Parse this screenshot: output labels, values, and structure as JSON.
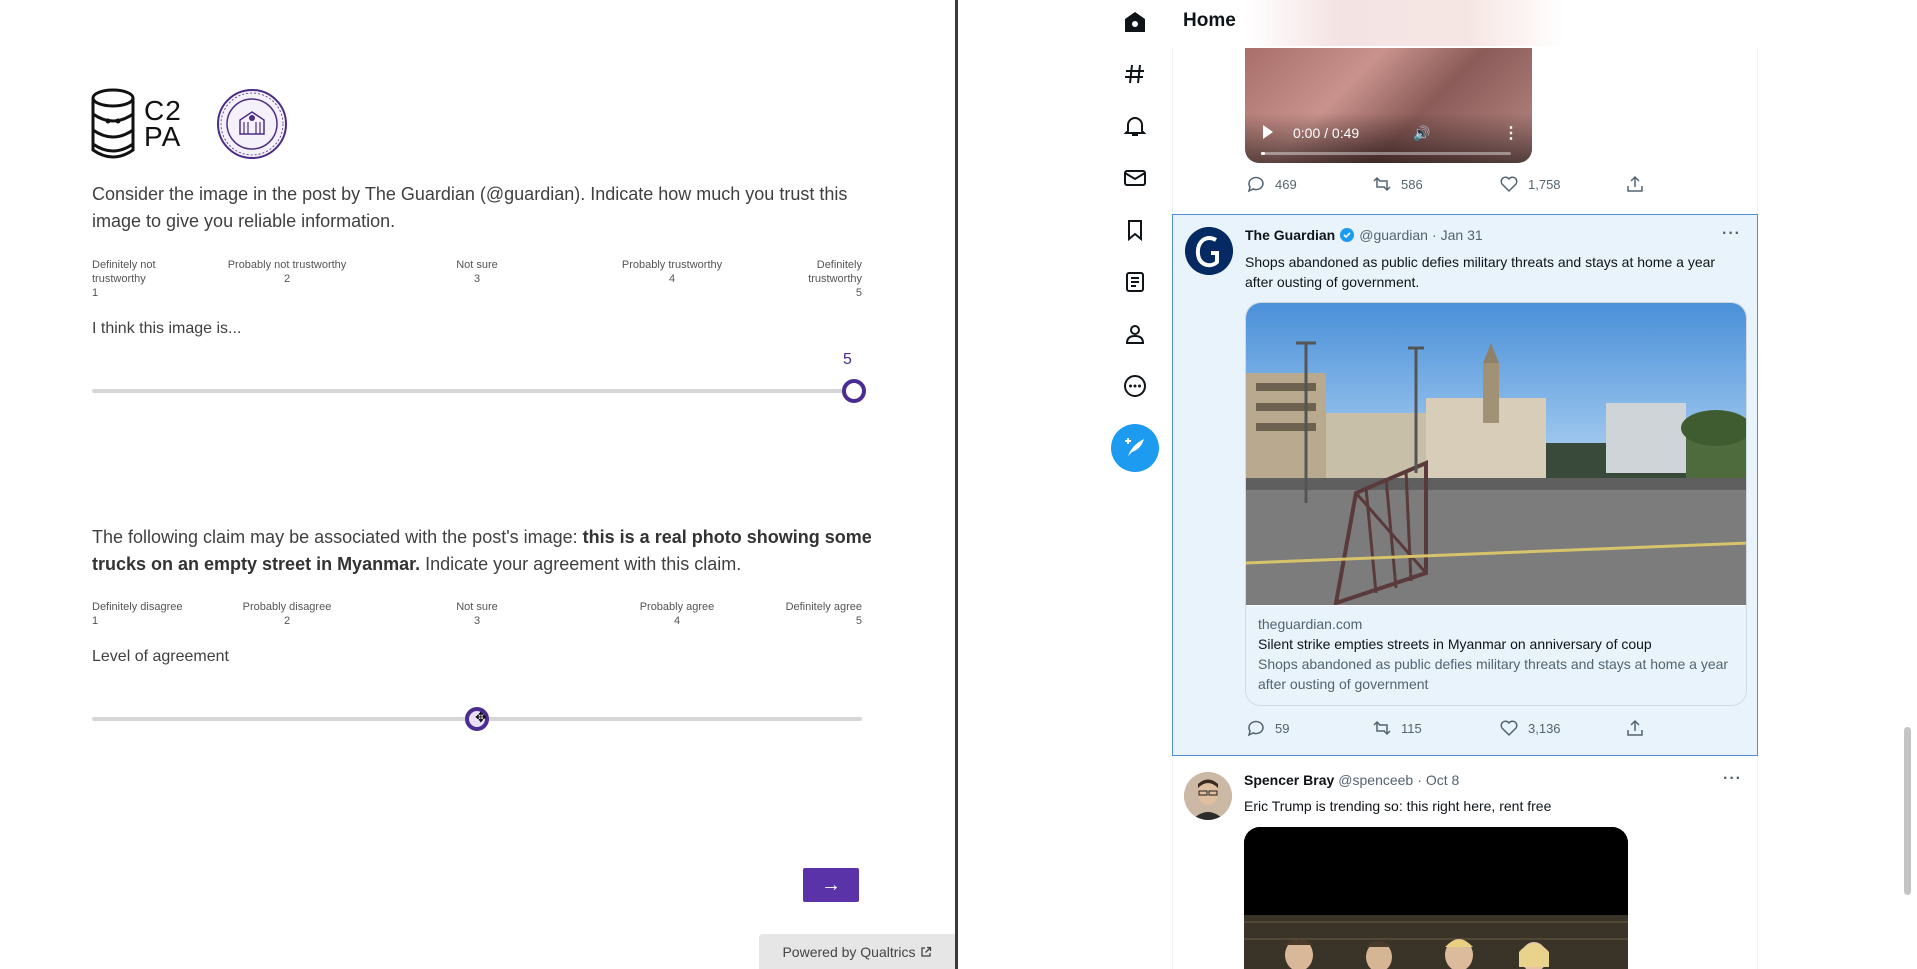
{
  "survey": {
    "logo_text": "C2\nPA",
    "question1": "Consider the image in the post by The Guardian (@guardian). Indicate how much you trust this image to give you reliable information.",
    "scale1": [
      {
        "label": "Definitely not trustworthy",
        "num": "1"
      },
      {
        "label": "Probably not trustworthy",
        "num": "2"
      },
      {
        "label": "Not sure",
        "num": "3"
      },
      {
        "label": "Probably trustworthy",
        "num": "4"
      },
      {
        "label": "Definitely trustworthy",
        "num": "5"
      }
    ],
    "slider1_label": "I think this image is...",
    "slider1_value": "5",
    "slider1_fraction": 1.0,
    "question2_prefix": "The following claim may be associated with the post's image: ",
    "question2_claim": "this is a real photo showing some trucks on an empty street in Myanmar.",
    "question2_suffix": " Indicate your agreement with this claim.",
    "scale2": [
      {
        "label": "Definitely disagree",
        "num": "1"
      },
      {
        "label": "Probably disagree",
        "num": "2"
      },
      {
        "label": "Not sure",
        "num": "3"
      },
      {
        "label": "Probably agree",
        "num": "4"
      },
      {
        "label": "Definitely agree",
        "num": "5"
      }
    ],
    "slider2_label": "Level of agreement",
    "slider2_fraction": 0.5,
    "next_label": "→",
    "powered_by": "Powered by Qualtrics"
  },
  "twitter": {
    "header_title": "Home",
    "nav_icons": [
      "home-icon",
      "explore-icon",
      "notifications-icon",
      "messages-icon",
      "bookmarks-icon",
      "lists-icon",
      "profile-icon",
      "more-icon"
    ],
    "video": {
      "time": "0:00 / 0:49",
      "progress_fraction": 0.0
    },
    "video_tweet_actions": {
      "replies": "469",
      "retweets": "586",
      "likes": "1,758"
    },
    "guardian_tweet": {
      "name": "The Guardian",
      "handle": "@guardian",
      "date": "Jan 31",
      "text": "Shops abandoned as public defies military threats and stays at home a year after ousting of government.",
      "card_domain": "theguardian.com",
      "card_title": "Silent strike empties streets in Myanmar on anniversary of coup",
      "card_desc": "Shops abandoned as public defies military threats and stays at home a year after ousting of government",
      "replies": "59",
      "retweets": "115",
      "likes": "3,136"
    },
    "spencer_tweet": {
      "name": "Spencer Bray",
      "handle": "@spenceeb",
      "date": "Oct 8",
      "text": "Eric Trump is trending so: this right here, rent free"
    },
    "accent_color": "#1d9bf0",
    "survey_accent_color": "#5b33a8"
  }
}
